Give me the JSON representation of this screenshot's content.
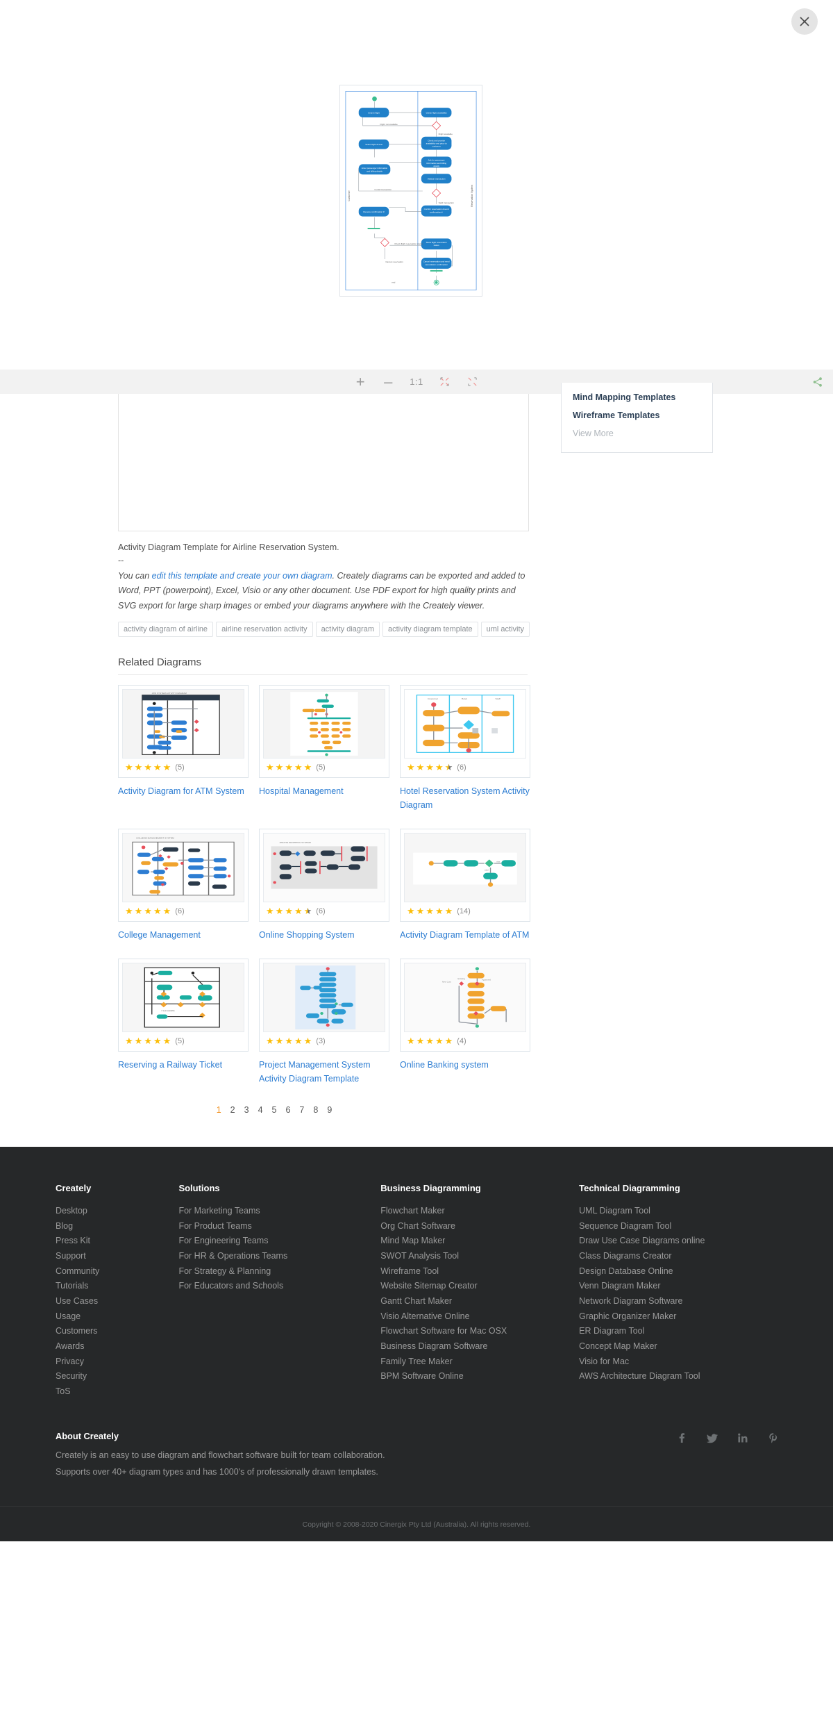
{
  "viewer": {
    "close_label": "×",
    "close_icon": "close-icon",
    "toolbar": {
      "zoom_in": "+",
      "zoom_out": "–",
      "ratio": "1:1",
      "fit_icon": "fit-to-screen-icon",
      "fullscreen_icon": "fullscreen-icon",
      "share_icon": "share-icon",
      "share_color": "#8fc08f"
    },
    "diagram": {
      "lane_left": "Customer",
      "lane_right": "Reservation System",
      "nodes": [
        "Search flight",
        "Check flight availability",
        "Select flight & seat",
        "Check and provide availability and price to customer",
        "Ask for passenger information and billing details",
        "Enter passenger information and billing details",
        "Validate transaction",
        "Receive confirmation #",
        "Confirm reservation & send confirmation #",
        "Show flight reservation status",
        "Cancel reservation and send cancellation confirmation"
      ],
      "edge_labels": [
        "Flight not available",
        "Flight available",
        "Invalid transaction",
        "Valid transaction",
        "Check flight reservation status",
        "Cancel reservation",
        "end"
      ],
      "node_color": "#2080c9",
      "decision_color": "#e8505b",
      "lane_border": "#4a90e2"
    }
  },
  "templates_panel": {
    "links": [
      "Mind Mapping Templates",
      "Wireframe Templates"
    ],
    "view_more": "View More"
  },
  "description": {
    "title": "Activity Diagram Template for Airline Reservation System.",
    "dashes": "--",
    "body_pre": "You can ",
    "link_text": "edit this template and create your own diagram",
    "body_post": ". Creately diagrams can be exported and added to Word, PPT (powerpoint), Excel, Visio or any other document. Use PDF export for high quality prints and SVG export for large sharp images or embed your diagrams anywhere with the Creately viewer.",
    "tags": [
      "activity diagram of airline",
      "airline reservation activity",
      "activity diagram",
      "activity diagram template",
      "uml activity"
    ]
  },
  "related": {
    "heading": "Related Diagrams",
    "items": [
      {
        "title": "Activity Diagram for ATM System",
        "rating": 5,
        "half": false,
        "count": "(5)",
        "thumb": "atm-swimlane-thumb"
      },
      {
        "title": "Hospital Management",
        "rating": 5,
        "half": false,
        "count": "(5)",
        "thumb": "hospital-thumb"
      },
      {
        "title": "Hotel Reservation System Activity Diagram",
        "rating": 4,
        "half": true,
        "count": "(6)",
        "thumb": "hotel-thumb"
      },
      {
        "title": "College Management",
        "rating": 5,
        "half": false,
        "count": "(6)",
        "thumb": "college-thumb"
      },
      {
        "title": "Online Shopping System",
        "rating": 4,
        "half": true,
        "count": "(6)",
        "thumb": "shopping-thumb"
      },
      {
        "title": "Activity Diagram Template of ATM",
        "rating": 5,
        "half": false,
        "count": "(14)",
        "thumb": "atm2-thumb"
      },
      {
        "title": "Reserving a Railway Ticket",
        "rating": 5,
        "half": false,
        "count": "(5)",
        "thumb": "railway-thumb"
      },
      {
        "title": "Project Management System Activity Diagram Template",
        "rating": 5,
        "half": false,
        "count": "(3)",
        "thumb": "project-thumb"
      },
      {
        "title": "Online Banking system",
        "rating": 5,
        "half": false,
        "count": "(4)",
        "thumb": "banking-thumb"
      }
    ]
  },
  "pagination": {
    "pages": [
      "1",
      "2",
      "3",
      "4",
      "5",
      "6",
      "7",
      "8",
      "9"
    ],
    "current": "1",
    "active_color": "#f0901e"
  },
  "footer": {
    "columns": [
      {
        "heading": "Creately",
        "links": [
          "Desktop",
          "Blog",
          "Press Kit",
          "Support",
          "Community",
          "Tutorials",
          "Use Cases",
          "Usage",
          "Customers",
          "Awards",
          "Privacy",
          "Security",
          "ToS"
        ]
      },
      {
        "heading": "Solutions",
        "links": [
          "For Marketing Teams",
          "For Product Teams",
          "For Engineering Teams",
          "For HR & Operations Teams",
          "For Strategy & Planning",
          "For Educators and Schools"
        ]
      },
      {
        "heading": "Business Diagramming",
        "links": [
          "Flowchart Maker",
          "Org Chart Software",
          "Mind Map Maker",
          "SWOT Analysis Tool",
          "Wireframe Tool",
          "Website Sitemap Creator",
          "Gantt Chart Maker",
          "Visio Alternative Online",
          "Flowchart Software for Mac OSX",
          "Business Diagram Software",
          "Family Tree Maker",
          "BPM Software Online"
        ]
      },
      {
        "heading": "Technical Diagramming",
        "links": [
          "UML Diagram Tool",
          "Sequence Diagram Tool",
          "Draw Use Case Diagrams online",
          "Class Diagrams Creator",
          "Design Database Online",
          "Venn Diagram Maker",
          "Network Diagram Software",
          "Graphic Organizer Maker",
          "ER Diagram Tool",
          "Concept Map Maker",
          "Visio for Mac",
          "AWS Architecture Diagram Tool"
        ]
      }
    ],
    "about": {
      "heading": "About Creately",
      "line1": "Creately is an easy to use diagram and flowchart software built for team collaboration.",
      "line2": "Supports over 40+ diagram types and has 1000's of professionally drawn templates."
    },
    "socials": [
      "facebook-icon",
      "twitter-icon",
      "linkedin-icon",
      "pinterest-icon"
    ],
    "social_glyphs": [
      "f",
      "🐦",
      "in",
      "℘"
    ],
    "copyright": "Copyright © 2008-2020 Cinergix Pty Ltd (Australia). All rights reserved."
  }
}
